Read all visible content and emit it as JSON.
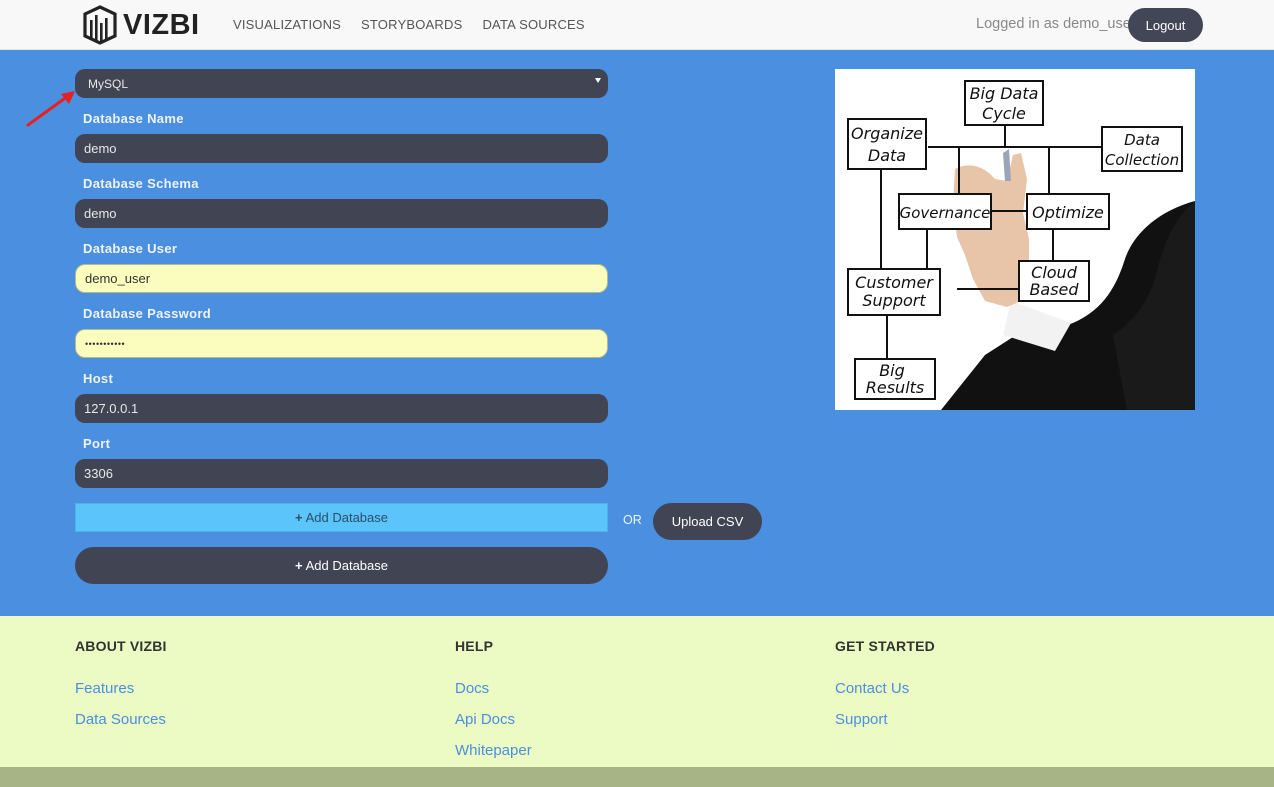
{
  "brand": {
    "name": "VIZBI"
  },
  "nav": {
    "links": [
      "VISUALIZATIONS",
      "STORYBOARDS",
      "DATA SOURCES"
    ],
    "logged_in_text": "Logged in as demo_user",
    "logout_label": "Logout"
  },
  "form": {
    "db_type": {
      "selected": "MySQL"
    },
    "database_name": {
      "label": "Database Name",
      "value": "demo"
    },
    "database_schema": {
      "label": "Database Schema",
      "value": "demo"
    },
    "database_user": {
      "label": "Database User",
      "value": "demo_user"
    },
    "database_password": {
      "label": "Database Password",
      "value": "•••••••••••"
    },
    "host": {
      "label": "Host",
      "value": "127.0.0.1"
    },
    "port": {
      "label": "Port",
      "value": "3306"
    },
    "add_database_label": "Add Database",
    "or_text": "OR",
    "upload_csv_label": "Upload CSV"
  },
  "hero": {
    "boxes": [
      "Big Data Cycle",
      "Organize Data",
      "Data Collection",
      "Governance",
      "Optimize",
      "Customer Support",
      "Cloud Based",
      "Big Results"
    ]
  },
  "footer": {
    "columns": [
      {
        "title": "ABOUT VIZBI",
        "links": [
          "Features",
          "Data Sources"
        ]
      },
      {
        "title": "HELP",
        "links": [
          "Docs",
          "Api Docs",
          "Whitepaper"
        ]
      },
      {
        "title": "GET STARTED",
        "links": [
          "Contact Us",
          "Support"
        ]
      }
    ]
  },
  "colors": {
    "navbar_bg": "#f8f8f8",
    "main_bg": "#4a8fe0",
    "field_bg": "#404453",
    "autofill_bg": "#fbfdbf",
    "accent_light_button": "#5bc4fa",
    "footer_bg": "#ecfbc3",
    "bottom_band": "#a6b486",
    "annotation_arrow": "#e8201f"
  }
}
